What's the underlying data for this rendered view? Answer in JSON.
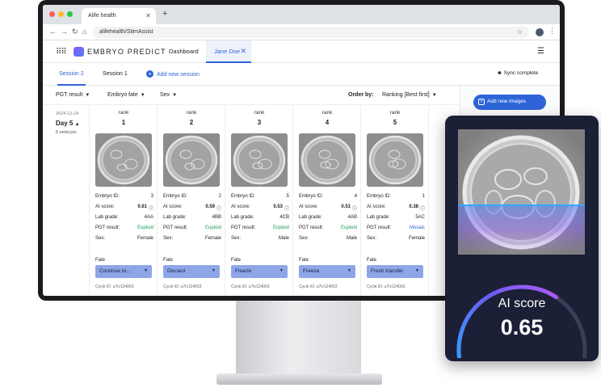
{
  "browser": {
    "tab_title": "Alife health",
    "url": "alifehealth/StimAssist"
  },
  "app": {
    "brand": "EMBRYO PREDICT",
    "nav_dashboard": "Dashboard",
    "nav_patient": "Jane Doe"
  },
  "sessions": {
    "tabs": [
      "Session 2",
      "Session 1"
    ],
    "add_label": "Add new session",
    "status": "Sync complete"
  },
  "filters": {
    "pgt": "PGT result",
    "fate": "Embryo fate",
    "sex": "Sex",
    "order_label": "Order by:",
    "order_value": "Ranking [Best first]"
  },
  "actions": {
    "add_images": "Add new images"
  },
  "day": {
    "date": "2024-12-24",
    "label": "Day 5",
    "count": "5 embryos"
  },
  "labels": {
    "rank": "rank",
    "embryo_id": "Embryo ID:",
    "ai_score": "AI score:",
    "lab_grade": "Lab grade:",
    "pgt": "PGT result:",
    "sex": "Sex:",
    "fate": "Fate"
  },
  "embryos": [
    {
      "rank": "1",
      "id": "3",
      "score": "0.61",
      "grade": "4AA",
      "pgt": "Euploid",
      "sex": "Female",
      "fate": "Continue to...",
      "cycle": "Cycle ID: u7iv124063"
    },
    {
      "rank": "2",
      "id": "2",
      "score": "0.59",
      "grade": "4BB",
      "pgt": "Euploid",
      "sex": "Female",
      "fate": "Discard",
      "cycle": "Cycle ID: u7iv124063"
    },
    {
      "rank": "3",
      "id": "5",
      "score": "0.53",
      "grade": "4CB",
      "pgt": "Euploid",
      "sex": "Male",
      "fate": "Freeze",
      "cycle": "Cycle ID: u7iv124063"
    },
    {
      "rank": "4",
      "id": "4",
      "score": "0.51",
      "grade": "4AB",
      "pgt": "Euploid",
      "sex": "Male",
      "fate": "Freeze",
      "cycle": "Cycle ID: u7iv124063"
    },
    {
      "rank": "5",
      "id": "1",
      "score": "0.38",
      "grade": "5AC",
      "pgt": "Mosaic",
      "sex": "Female",
      "fate": "Fresh transfer",
      "cycle": "Cycle ID: u7iv124063"
    }
  ],
  "ai_panel": {
    "label": "AI score",
    "value": "0.65",
    "gauge_fraction": 0.65
  },
  "colors": {
    "accent": "#2d64d8",
    "euploid": "#1e9e57",
    "mosaic": "#2d64d8",
    "panel_bg": "#1b2037"
  }
}
